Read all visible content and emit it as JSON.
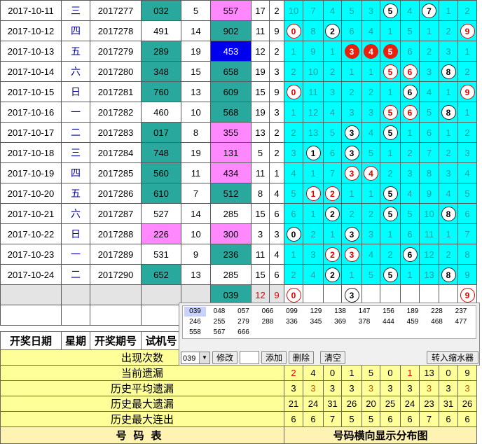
{
  "rows": [
    {
      "date": "2017-10-11",
      "week": "三",
      "issue": "2017277",
      "test": "032",
      "test_sum": "5",
      "award": "557",
      "award_sum": "17",
      "span": "2",
      "cells": [
        [
          "10",
          "n"
        ],
        [
          "7",
          "n"
        ],
        [
          "4",
          "n"
        ],
        [
          "5",
          "n"
        ],
        [
          "3",
          "n"
        ],
        [
          "5",
          "b"
        ],
        [
          "4",
          "n"
        ],
        [
          "7",
          "b"
        ],
        [
          "1",
          "n"
        ],
        [
          "2",
          "n"
        ]
      ],
      "tstyle": "c",
      "astyle": "pk"
    },
    {
      "date": "2017-10-12",
      "week": "四",
      "issue": "2017278",
      "test": "491",
      "test_sum": "14",
      "award": "902",
      "award_sum": "11",
      "span": "9",
      "cells": [
        [
          "0",
          "r"
        ],
        [
          "8",
          "n"
        ],
        [
          "2",
          "b"
        ],
        [
          "6",
          "n"
        ],
        [
          "4",
          "n"
        ],
        [
          "1",
          "n"
        ],
        [
          "5",
          "n"
        ],
        [
          "1",
          "n"
        ],
        [
          "2",
          "n"
        ],
        [
          "9",
          "r"
        ]
      ],
      "tstyle": "w",
      "astyle": "c"
    },
    {
      "date": "2017-10-13",
      "week": "五",
      "issue": "2017279",
      "test": "289",
      "test_sum": "19",
      "award": "453",
      "award_sum": "12",
      "span": "2",
      "cells": [
        [
          "1",
          "n"
        ],
        [
          "9",
          "n"
        ],
        [
          "1",
          "n"
        ],
        [
          "3",
          "f"
        ],
        [
          "4",
          "f"
        ],
        [
          "5",
          "f"
        ],
        [
          "6",
          "n"
        ],
        [
          "2",
          "n"
        ],
        [
          "3",
          "n"
        ],
        [
          "1",
          "n"
        ]
      ],
      "tstyle": "c",
      "astyle": "bl"
    },
    {
      "date": "2017-10-14",
      "week": "六",
      "issue": "2017280",
      "test": "348",
      "test_sum": "15",
      "award": "658",
      "award_sum": "19",
      "span": "3",
      "cells": [
        [
          "2",
          "n"
        ],
        [
          "10",
          "n"
        ],
        [
          "2",
          "n"
        ],
        [
          "1",
          "n"
        ],
        [
          "1",
          "n"
        ],
        [
          "5",
          "r"
        ],
        [
          "6",
          "r"
        ],
        [
          "3",
          "n"
        ],
        [
          "8",
          "b"
        ],
        [
          "2",
          "n"
        ]
      ],
      "tstyle": "c",
      "astyle": "c"
    },
    {
      "date": "2017-10-15",
      "week": "日",
      "issue": "2017281",
      "test": "760",
      "test_sum": "13",
      "award": "609",
      "award_sum": "15",
      "span": "9",
      "cells": [
        [
          "0",
          "r"
        ],
        [
          "11",
          "n"
        ],
        [
          "3",
          "n"
        ],
        [
          "2",
          "n"
        ],
        [
          "2",
          "n"
        ],
        [
          "1",
          "n"
        ],
        [
          "6",
          "b"
        ],
        [
          "4",
          "n"
        ],
        [
          "1",
          "n"
        ],
        [
          "9",
          "r"
        ]
      ],
      "tstyle": "c",
      "astyle": "c"
    },
    {
      "date": "2017-10-16",
      "week": "一",
      "issue": "2017282",
      "test": "460",
      "test_sum": "10",
      "award": "568",
      "award_sum": "19",
      "span": "3",
      "cells": [
        [
          "1",
          "n"
        ],
        [
          "12",
          "n"
        ],
        [
          "4",
          "n"
        ],
        [
          "3",
          "n"
        ],
        [
          "3",
          "n"
        ],
        [
          "5",
          "r"
        ],
        [
          "6",
          "r"
        ],
        [
          "5",
          "n"
        ],
        [
          "8",
          "b"
        ],
        [
          "1",
          "n"
        ]
      ],
      "tstyle": "w",
      "astyle": "c"
    },
    {
      "date": "2017-10-17",
      "week": "二",
      "issue": "2017283",
      "test": "017",
      "test_sum": "8",
      "award": "355",
      "award_sum": "13",
      "span": "2",
      "cells": [
        [
          "2",
          "n"
        ],
        [
          "13",
          "n"
        ],
        [
          "5",
          "n"
        ],
        [
          "3",
          "b"
        ],
        [
          "4",
          "n"
        ],
        [
          "5",
          "b"
        ],
        [
          "1",
          "n"
        ],
        [
          "6",
          "n"
        ],
        [
          "1",
          "n"
        ],
        [
          "2",
          "n"
        ]
      ],
      "tstyle": "c",
      "astyle": "pk"
    },
    {
      "date": "2017-10-18",
      "week": "三",
      "issue": "2017284",
      "test": "748",
      "test_sum": "19",
      "award": "131",
      "award_sum": "5",
      "span": "2",
      "cells": [
        [
          "3",
          "n"
        ],
        [
          "1",
          "b"
        ],
        [
          "6",
          "n"
        ],
        [
          "3",
          "b"
        ],
        [
          "5",
          "n"
        ],
        [
          "1",
          "n"
        ],
        [
          "2",
          "n"
        ],
        [
          "7",
          "n"
        ],
        [
          "2",
          "n"
        ],
        [
          "3",
          "n"
        ]
      ],
      "tstyle": "c",
      "astyle": "pk"
    },
    {
      "date": "2017-10-19",
      "week": "四",
      "issue": "2017285",
      "test": "560",
      "test_sum": "11",
      "award": "434",
      "award_sum": "11",
      "span": "1",
      "cells": [
        [
          "4",
          "n"
        ],
        [
          "1",
          "n"
        ],
        [
          "7",
          "n"
        ],
        [
          "3",
          "r"
        ],
        [
          "4",
          "r"
        ],
        [
          "2",
          "n"
        ],
        [
          "3",
          "n"
        ],
        [
          "8",
          "n"
        ],
        [
          "3",
          "n"
        ],
        [
          "4",
          "n"
        ]
      ],
      "tstyle": "c",
      "astyle": "pk"
    },
    {
      "date": "2017-10-20",
      "week": "五",
      "issue": "2017286",
      "test": "610",
      "test_sum": "7",
      "award": "512",
      "award_sum": "8",
      "span": "4",
      "cells": [
        [
          "5",
          "n"
        ],
        [
          "1",
          "r"
        ],
        [
          "2",
          "r"
        ],
        [
          "1",
          "n"
        ],
        [
          "1",
          "n"
        ],
        [
          "5",
          "b"
        ],
        [
          "4",
          "n"
        ],
        [
          "9",
          "n"
        ],
        [
          "4",
          "n"
        ],
        [
          "5",
          "n"
        ]
      ],
      "tstyle": "c",
      "astyle": "c"
    },
    {
      "date": "2017-10-21",
      "week": "六",
      "issue": "2017287",
      "test": "527",
      "test_sum": "14",
      "award": "285",
      "award_sum": "15",
      "span": "6",
      "cells": [
        [
          "6",
          "n"
        ],
        [
          "1",
          "n"
        ],
        [
          "2",
          "b"
        ],
        [
          "2",
          "n"
        ],
        [
          "2",
          "n"
        ],
        [
          "5",
          "b"
        ],
        [
          "5",
          "n"
        ],
        [
          "10",
          "n"
        ],
        [
          "8",
          "b"
        ],
        [
          "6",
          "n"
        ]
      ],
      "tstyle": "w",
      "astyle": "w"
    },
    {
      "date": "2017-10-22",
      "week": "日",
      "issue": "2017288",
      "test": "226",
      "test_sum": "10",
      "award": "300",
      "award_sum": "3",
      "span": "3",
      "cells": [
        [
          "0",
          "b"
        ],
        [
          "2",
          "n"
        ],
        [
          "1",
          "n"
        ],
        [
          "3",
          "b"
        ],
        [
          "3",
          "n"
        ],
        [
          "1",
          "n"
        ],
        [
          "6",
          "n"
        ],
        [
          "11",
          "n"
        ],
        [
          "1",
          "n"
        ],
        [
          "7",
          "n"
        ]
      ],
      "tstyle": "pk",
      "astyle": "pk"
    },
    {
      "date": "2017-10-23",
      "week": "一",
      "issue": "2017289",
      "test": "531",
      "test_sum": "9",
      "award": "236",
      "award_sum": "11",
      "span": "4",
      "cells": [
        [
          "1",
          "n"
        ],
        [
          "3",
          "n"
        ],
        [
          "2",
          "r"
        ],
        [
          "3",
          "r"
        ],
        [
          "4",
          "n"
        ],
        [
          "2",
          "n"
        ],
        [
          "6",
          "b"
        ],
        [
          "12",
          "n"
        ],
        [
          "2",
          "n"
        ],
        [
          "8",
          "n"
        ]
      ],
      "tstyle": "w",
      "astyle": "c"
    },
    {
      "date": "2017-10-24",
      "week": "二",
      "issue": "2017290",
      "test": "652",
      "test_sum": "13",
      "award": "285",
      "award_sum": "15",
      "span": "6",
      "cells": [
        [
          "2",
          "n"
        ],
        [
          "4",
          "n"
        ],
        [
          "2",
          "b"
        ],
        [
          "1",
          "n"
        ],
        [
          "5",
          "n"
        ],
        [
          "5",
          "b"
        ],
        [
          "1",
          "n"
        ],
        [
          "13",
          "n"
        ],
        [
          "8",
          "b"
        ],
        [
          "9",
          "n"
        ]
      ],
      "tstyle": "c",
      "astyle": "w"
    }
  ],
  "predict": {
    "award": "039",
    "award_sum": "12",
    "span": "9",
    "cells": [
      [
        "0",
        "r"
      ],
      [
        "",
        ""
      ],
      [
        "",
        ""
      ],
      [
        "3",
        "b"
      ],
      [
        "",
        ""
      ],
      [
        "",
        ""
      ],
      [
        "",
        ""
      ],
      [
        "",
        ""
      ],
      [
        "",
        ""
      ],
      [
        "9",
        "r"
      ]
    ]
  },
  "headers": {
    "date": "开奖日期",
    "week": "星期",
    "issue": "开奖期号",
    "test": "试机号"
  },
  "stats": [
    {
      "label": "出现次数",
      "values": []
    },
    {
      "label": "当前遗漏",
      "values": [
        "2",
        "4",
        "0",
        "1",
        "5",
        "0",
        "1",
        "13",
        "0",
        "9"
      ]
    },
    {
      "label": "历史平均遗漏",
      "values": [
        "3",
        "3",
        "3",
        "3",
        "3",
        "3",
        "3",
        "3",
        "3",
        "3"
      ]
    },
    {
      "label": "历史最大遗漏",
      "values": [
        "21",
        "24",
        "31",
        "26",
        "20",
        "25",
        "24",
        "23",
        "31",
        "26"
      ]
    },
    {
      "label": "历史最大连出",
      "values": [
        "6",
        "6",
        "7",
        "5",
        "5",
        "6",
        "6",
        "7",
        "6",
        "6"
      ]
    }
  ],
  "footer": {
    "left": "号码表",
    "right": "号码横向显示分布图"
  },
  "panel": {
    "numbers": [
      "039",
      "048",
      "057",
      "066",
      "099",
      "129",
      "138",
      "147",
      "156",
      "189",
      "228",
      "237",
      "246",
      "255",
      "279",
      "288",
      "336",
      "345",
      "369",
      "378",
      "444",
      "459",
      "468",
      "477",
      "558",
      "567",
      "666"
    ],
    "combo_value": "039",
    "btn_modify": "修改",
    "btn_add": "添加",
    "btn_delete": "删除",
    "btn_clear": "清空",
    "btn_transfer": "转入缩水器"
  },
  "colors": {
    "cyan": "#00ffff",
    "teal": "#29a99d",
    "pink": "#ff88ff",
    "blue": "#0000ee",
    "red": "#e00000",
    "yellow": "#ffff99"
  }
}
